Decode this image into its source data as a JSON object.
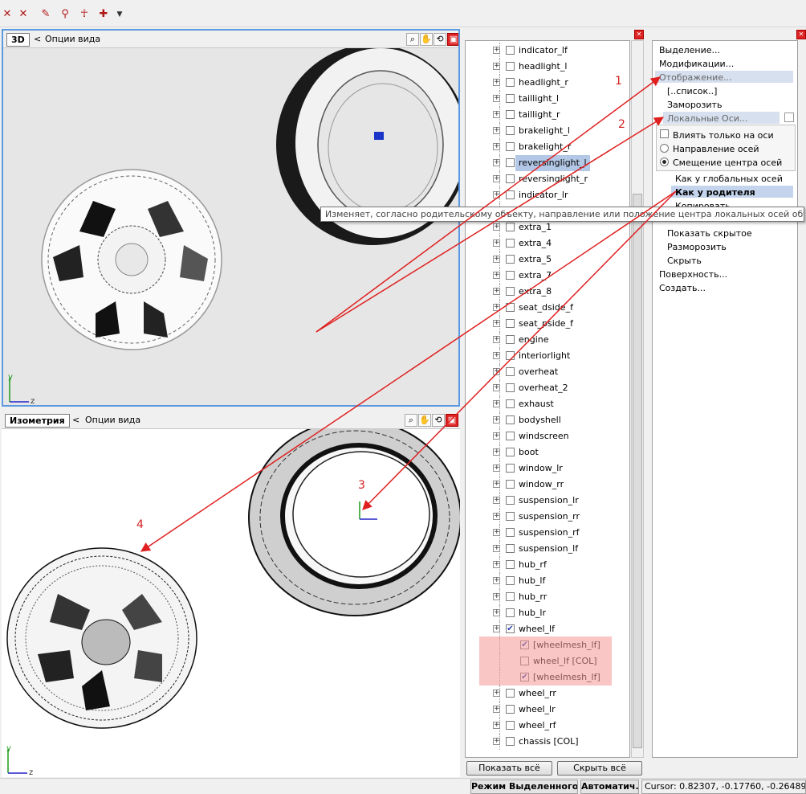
{
  "viewports": {
    "top": {
      "label": "3D",
      "options": "Опции вида",
      "back": "<"
    },
    "bottom": {
      "label": "Изометрия",
      "options": "Опции вида",
      "back": "<"
    }
  },
  "tree": {
    "items": [
      {
        "label": "indicator_lf",
        "checked": false
      },
      {
        "label": "headlight_l",
        "checked": false
      },
      {
        "label": "headlight_r",
        "checked": false
      },
      {
        "label": "taillight_l",
        "checked": false
      },
      {
        "label": "taillight_r",
        "checked": false
      },
      {
        "label": "brakelight_l",
        "checked": false
      },
      {
        "label": "brakelight_r",
        "checked": false
      },
      {
        "label": "reversinglight_l",
        "checked": false,
        "selected": true
      },
      {
        "label": "reversinglight_r",
        "checked": false
      },
      {
        "label": "indicator_lr",
        "checked": false
      },
      {
        "label": "",
        "checked": false
      },
      {
        "label": "extra_1",
        "checked": false
      },
      {
        "label": "extra_4",
        "checked": false
      },
      {
        "label": "extra_5",
        "checked": false
      },
      {
        "label": "extra_7",
        "checked": false
      },
      {
        "label": "extra_8",
        "checked": false
      },
      {
        "label": "seat_dside_f",
        "checked": false
      },
      {
        "label": "seat_pside_f",
        "checked": false
      },
      {
        "label": "engine",
        "checked": false
      },
      {
        "label": "interiorlight",
        "checked": false
      },
      {
        "label": "overheat",
        "checked": false
      },
      {
        "label": "overheat_2",
        "checked": false
      },
      {
        "label": "exhaust",
        "checked": false
      },
      {
        "label": "bodyshell",
        "checked": false
      },
      {
        "label": "windscreen",
        "checked": false
      },
      {
        "label": "boot",
        "checked": false
      },
      {
        "label": "window_lr",
        "checked": false
      },
      {
        "label": "window_rr",
        "checked": false
      },
      {
        "label": "suspension_lr",
        "checked": false
      },
      {
        "label": "suspension_rr",
        "checked": false
      },
      {
        "label": "suspension_rf",
        "checked": false
      },
      {
        "label": "suspension_lf",
        "checked": false
      },
      {
        "label": "hub_rf",
        "checked": false
      },
      {
        "label": "hub_lf",
        "checked": false
      },
      {
        "label": "hub_rr",
        "checked": false
      },
      {
        "label": "hub_lr",
        "checked": false
      },
      {
        "label": "wheel_lf",
        "checked": true
      },
      {
        "label": "[wheelmesh_lf]",
        "checked": true,
        "child": true
      },
      {
        "label": "wheel_lf [COL]",
        "checked": false,
        "child": true
      },
      {
        "label": "[wheelmesh_lf]",
        "checked": true,
        "child": true
      },
      {
        "label": "wheel_rr",
        "checked": false
      },
      {
        "label": "wheel_lr",
        "checked": false
      },
      {
        "label": "wheel_rf",
        "checked": false
      },
      {
        "label": "chassis [COL]",
        "checked": false
      }
    ],
    "show_all": "Показать всё",
    "hide_all": "Скрыть всё"
  },
  "menu": {
    "selection": "Выделение...",
    "modifications": "Модификации...",
    "display": "Отображение...",
    "list": "[..список..]",
    "freeze": "Заморозить",
    "local_axes": "Локальные Оси...",
    "opt_only_axes": "Влиять только на оси",
    "opt_direction": "Направление осей",
    "opt_offset": "Смещение центра осей",
    "as_global": "Как у глобальных осей",
    "as_parent": "Как у родителя",
    "copy": "Копировать",
    "show_hidden": "Показать скрытое",
    "unfreeze": "Разморозить",
    "hide": "Скрыть",
    "surface": "Поверхность...",
    "create": "Создать..."
  },
  "tooltip": "Изменяет, согласно родительскому объекту, направление или положение центра локальных осей объекта.",
  "annotations": [
    "1",
    "2",
    "3",
    "4"
  ],
  "axes": {
    "y": "y",
    "z": "z"
  },
  "status": {
    "mode": "Режим Выделенного",
    "auto": "Автоматич.",
    "cursor": "Cursor: 0.82307, -0.17760, -0.26489"
  },
  "colors": {
    "accent": "#3a7bd5",
    "annotation": "#e02020",
    "highlight": "#f4b6b6"
  }
}
